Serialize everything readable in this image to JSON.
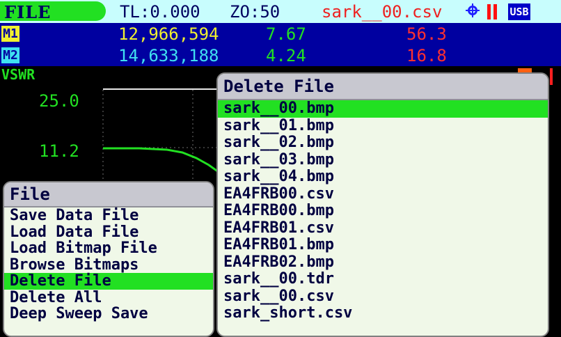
{
  "statusbar": {
    "mode": "FILE",
    "tl": "TL:0.000",
    "zo": "ZO:50",
    "filename": "sark__00.csv",
    "usb": "USB",
    "icons": [
      "satellite-icon",
      "pause-icon",
      "usb-icon"
    ]
  },
  "markers": [
    {
      "badge": "M1",
      "frequency": "12,966,594",
      "value1": "7.67",
      "value2": "56.3"
    },
    {
      "badge": "M2",
      "frequency": "14,633,188",
      "value1": "4.24",
      "value2": "16.8"
    }
  ],
  "plot": {
    "title": "VSWR",
    "ticks": [
      "25.0",
      "11.2"
    ]
  },
  "file_menu": {
    "title": "File",
    "items": [
      "Save Data File",
      "Load Data File",
      "Load Bitmap File",
      "Browse Bitmaps",
      "Delete File",
      "Delete All",
      "Deep Sweep Save"
    ],
    "selected": "Delete File"
  },
  "delete_menu": {
    "title": "Delete File",
    "items": [
      "sark__00.bmp",
      "sark__01.bmp",
      "sark__02.bmp",
      "sark__03.bmp",
      "sark__04.bmp",
      "EA4FRB00.csv",
      "EA4FRB00.bmp",
      "EA4FRB01.csv",
      "EA4FRB01.bmp",
      "EA4FRB02.bmp",
      "sark__00.tdr",
      "sark__00.csv",
      "sark_short.csv"
    ],
    "selected": "sark__00.bmp"
  },
  "colors": {
    "accent_green": "#22e022",
    "marker_bar": "#0000a0",
    "status_bar": "#c8fdfd",
    "filename_red": "#ee2020"
  }
}
